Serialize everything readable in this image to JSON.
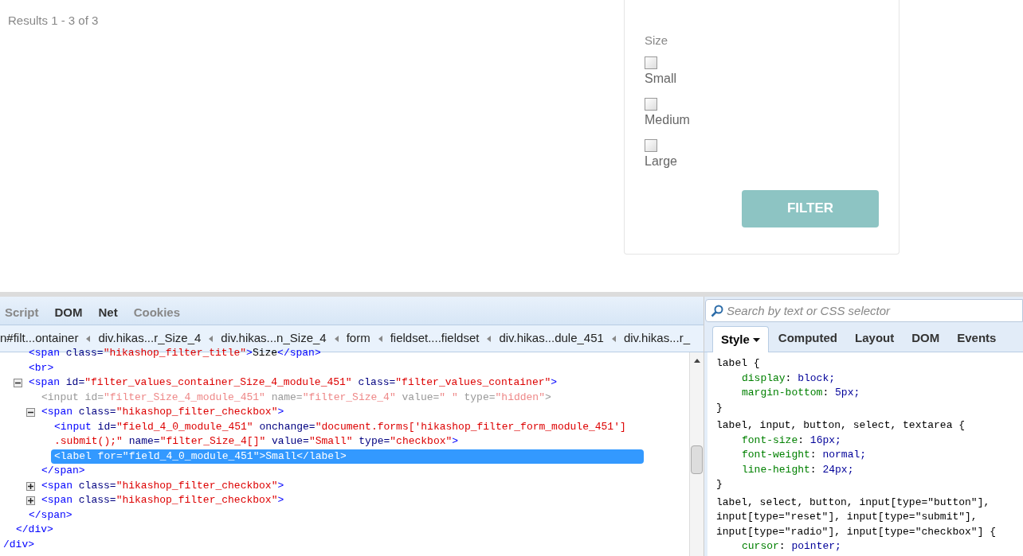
{
  "page": {
    "results": "Results 1 - 3 of 3",
    "filter": {
      "title": "Size",
      "options": [
        {
          "label": "Small",
          "checked": false
        },
        {
          "label": "Medium",
          "checked": false
        },
        {
          "label": "Large",
          "checked": false
        }
      ],
      "button": "FILTER"
    }
  },
  "devtools": {
    "tabs": [
      {
        "label": "Script",
        "disabled": true
      },
      {
        "label": "DOM",
        "disabled": false
      },
      {
        "label": "Net",
        "disabled": false
      },
      {
        "label": "Cookies",
        "disabled": true
      }
    ],
    "search": {
      "placeholder": "Search by text or CSS selector"
    },
    "breadcrumbs": [
      "n#filt...ontainer",
      "div.hikas...r_Size_4",
      "div.hikas...n_Size_4",
      "form",
      "fieldset....fieldset",
      "div.hikas...dule_451",
      "div.hikas...r_"
    ],
    "tree": [
      {
        "close": [
          {
            "kind": "punct",
            "text": "/div>"
          }
        ],
        "children": [
          {
            "close": [
              {
                "kind": "punct",
                "text": "</div>"
              }
            ],
            "children": [
              {
                "tokens": [
                  {
                    "kind": "punct",
                    "text": "<span "
                  },
                  {
                    "kind": "attr",
                    "text": "class="
                  },
                  {
                    "kind": "value",
                    "text": "\"hikashop_filter_title\""
                  },
                  {
                    "kind": "punct",
                    "text": ">"
                  },
                  {
                    "kind": "text",
                    "text": "Size"
                  },
                  {
                    "kind": "punct",
                    "text": "</span>"
                  }
                ]
              },
              {
                "tokens": [
                  {
                    "kind": "punct",
                    "text": "<br>"
                  }
                ]
              },
              {
                "expanded": true,
                "tokens": [
                  {
                    "kind": "punct",
                    "text": "<span "
                  },
                  {
                    "kind": "attr",
                    "text": "id="
                  },
                  {
                    "kind": "value",
                    "text": "\"filter_values_container_Size_4_module_451\""
                  },
                  {
                    "kind": "attr",
                    "text": " class="
                  },
                  {
                    "kind": "value",
                    "text": "\"filter_values_container\""
                  },
                  {
                    "kind": "punct",
                    "text": ">"
                  }
                ],
                "close": [
                  {
                    "kind": "punct",
                    "text": "</span>"
                  }
                ],
                "children": [
                  {
                    "dim": true,
                    "tokens": [
                      {
                        "kind": "punct",
                        "text": "<input "
                      },
                      {
                        "kind": "attr",
                        "text": "id="
                      },
                      {
                        "kind": "value",
                        "text": "\"filter_Size_4_module_451\""
                      },
                      {
                        "kind": "attr",
                        "text": " name="
                      },
                      {
                        "kind": "value",
                        "text": "\"filter_Size_4\""
                      },
                      {
                        "kind": "attr",
                        "text": " value="
                      },
                      {
                        "kind": "value",
                        "text": "\" \""
                      },
                      {
                        "kind": "attr",
                        "text": " type="
                      },
                      {
                        "kind": "value",
                        "text": "\"hidden\""
                      },
                      {
                        "kind": "punct",
                        "text": ">"
                      }
                    ]
                  },
                  {
                    "expanded": true,
                    "tokens": [
                      {
                        "kind": "punct",
                        "text": "<span "
                      },
                      {
                        "kind": "attr",
                        "text": "class="
                      },
                      {
                        "kind": "value",
                        "text": "\"hikashop_filter_checkbox\""
                      },
                      {
                        "kind": "punct",
                        "text": ">"
                      }
                    ],
                    "close": [
                      {
                        "kind": "punct",
                        "text": "</span>"
                      }
                    ],
                    "children": [
                      {
                        "tokens": [
                          {
                            "kind": "punct",
                            "text": "<input "
                          },
                          {
                            "kind": "attr",
                            "text": "id="
                          },
                          {
                            "kind": "value",
                            "text": "\"field_4_0_module_451\""
                          },
                          {
                            "kind": "attr",
                            "text": " onchange="
                          },
                          {
                            "kind": "value",
                            "text": "\"document.forms['hikashop_filter_form_module_451']"
                          }
                        ],
                        "continuation": [
                          {
                            "kind": "value",
                            "text": ".submit();\""
                          },
                          {
                            "kind": "attr",
                            "text": " name="
                          },
                          {
                            "kind": "value",
                            "text": "\"filter_Size_4[]\""
                          },
                          {
                            "kind": "attr",
                            "text": " value="
                          },
                          {
                            "kind": "value",
                            "text": "\"Small\""
                          },
                          {
                            "kind": "attr",
                            "text": " type="
                          },
                          {
                            "kind": "value",
                            "text": "\"checkbox\""
                          },
                          {
                            "kind": "punct",
                            "text": ">"
                          }
                        ]
                      },
                      {
                        "selected": true,
                        "tokens": [
                          {
                            "kind": "punct",
                            "text": "<label "
                          },
                          {
                            "kind": "attr",
                            "text": "for="
                          },
                          {
                            "kind": "value",
                            "text": "\"field_4_0_module_451\""
                          },
                          {
                            "kind": "punct",
                            "text": ">"
                          },
                          {
                            "kind": "text",
                            "text": "Small"
                          },
                          {
                            "kind": "punct",
                            "text": "</label>"
                          }
                        ]
                      }
                    ]
                  },
                  {
                    "expanded": false,
                    "tokens": [
                      {
                        "kind": "punct",
                        "text": "<span "
                      },
                      {
                        "kind": "attr",
                        "text": "class="
                      },
                      {
                        "kind": "value",
                        "text": "\"hikashop_filter_checkbox\""
                      },
                      {
                        "kind": "punct",
                        "text": ">"
                      }
                    ]
                  },
                  {
                    "expanded": false,
                    "tokens": [
                      {
                        "kind": "punct",
                        "text": "<span "
                      },
                      {
                        "kind": "attr",
                        "text": "class="
                      },
                      {
                        "kind": "value",
                        "text": "\"hikashop_filter_checkbox\""
                      },
                      {
                        "kind": "punct",
                        "text": ">"
                      }
                    ]
                  }
                ]
              }
            ]
          }
        ]
      }
    ],
    "side_tabs": [
      {
        "label": "Style",
        "selected": true,
        "menu": true
      },
      {
        "label": "Computed",
        "selected": false
      },
      {
        "label": "Layout",
        "selected": false
      },
      {
        "label": "DOM",
        "selected": false
      },
      {
        "label": "Events",
        "selected": false
      }
    ],
    "rules": [
      {
        "selector_lines": [
          "label {"
        ],
        "declarations": [
          {
            "property": "display",
            "colon": ":",
            "value": "block;"
          },
          {
            "property": "margin-bottom",
            "colon": ":",
            "value": "5px;"
          }
        ],
        "end": "}"
      },
      {
        "selector_lines": [
          "label, input, button, select, textarea {"
        ],
        "declarations": [
          {
            "property": "font-size",
            "colon": ":",
            "value": "16px;"
          },
          {
            "property": "font-weight",
            "colon": ":",
            "value": "normal;"
          },
          {
            "property": "line-height",
            "colon": ":",
            "value": "24px;"
          }
        ],
        "end": "}"
      },
      {
        "selector_lines": [
          "label, select, button, input[type=\"button\"],",
          "input[type=\"reset\"], input[type=\"submit\"],",
          "input[type=\"radio\"], input[type=\"checkbox\"] {"
        ],
        "declarations": [
          {
            "property": "cursor",
            "colon": ":",
            "value": "pointer;"
          }
        ]
      }
    ]
  }
}
